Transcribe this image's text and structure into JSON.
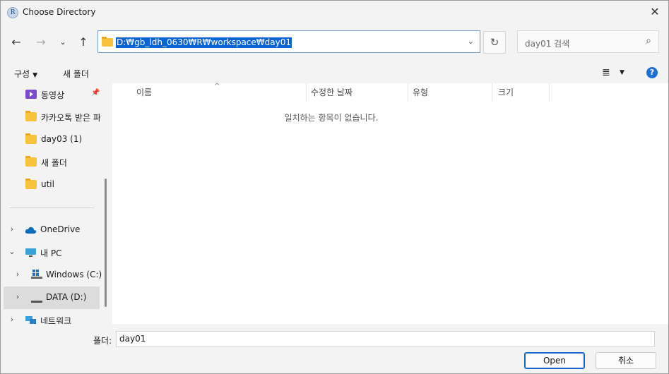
{
  "window": {
    "title": "Choose Directory",
    "icon_letter": "R"
  },
  "address": {
    "path": "D:₩gb_ldh_0630₩R₩workspace₩day01"
  },
  "search": {
    "placeholder": "day01 검색"
  },
  "toolbar": {
    "organize_label": "구성",
    "new_folder_label": "새 폴더"
  },
  "sidebar": {
    "quick_items": [
      {
        "label": "동영상",
        "icon": "video-folder-icon",
        "pinned": true
      },
      {
        "label": "카카오톡 받은 파",
        "icon": "folder-icon"
      },
      {
        "label": "day03 (1)",
        "icon": "folder-icon"
      },
      {
        "label": "새 폴더",
        "icon": "folder-icon"
      },
      {
        "label": "util",
        "icon": "folder-icon"
      }
    ],
    "tree_items": [
      {
        "label": "OneDrive",
        "icon": "cloud-icon",
        "expander": "collapsed"
      },
      {
        "label": "내 PC",
        "icon": "pc-icon",
        "expander": "expanded"
      },
      {
        "label": "Windows (C:)",
        "icon": "windows-drive-icon",
        "expander": "collapsed"
      },
      {
        "label": "DATA (D:)",
        "icon": "drive-icon",
        "expander": "collapsed",
        "selected": true
      },
      {
        "label": "네트워크",
        "icon": "network-icon",
        "expander": "collapsed"
      }
    ]
  },
  "columns": [
    "이름",
    "수정한 날짜",
    "유형",
    "크기"
  ],
  "empty_message": "일치하는 항목이 없습니다.",
  "footer": {
    "folder_label": "폴더:",
    "folder_value": "day01",
    "open_label": "Open",
    "cancel_label": "취소"
  },
  "colors": {
    "accent": "#0a64d6",
    "folder": "#f7c23c"
  }
}
